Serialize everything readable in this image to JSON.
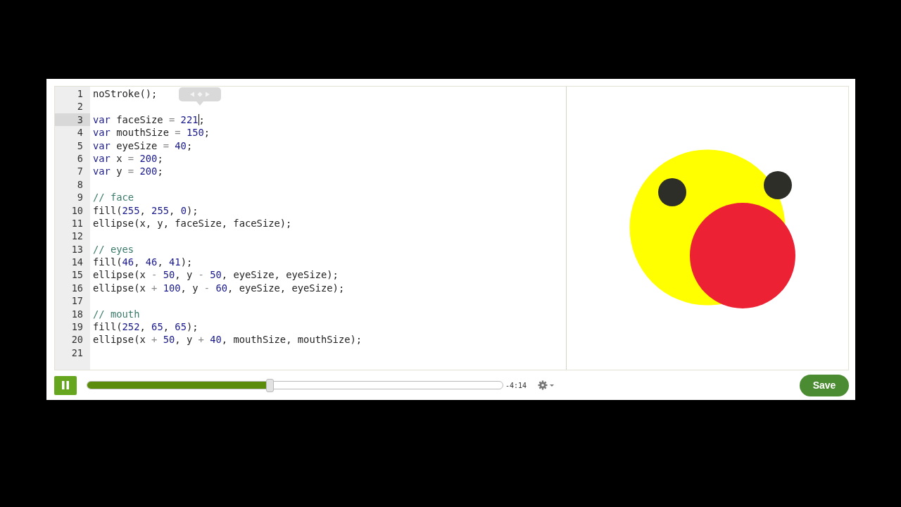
{
  "editor": {
    "lines": [
      {
        "number": "1",
        "active": false,
        "tokens": [
          {
            "kind": "text",
            "text": "noStroke();"
          }
        ]
      },
      {
        "number": "2",
        "active": false
      },
      {
        "number": "3",
        "active": true,
        "tokens": [
          {
            "kind": "keyword",
            "text": "var"
          },
          {
            "kind": "text",
            "text": " faceSize"
          },
          {
            "kind": "op",
            "text": " = "
          },
          {
            "kind": "number",
            "text": "221"
          },
          {
            "kind": "cursor"
          },
          {
            "kind": "text",
            "text": ";"
          }
        ]
      },
      {
        "number": "4",
        "active": false,
        "tokens": [
          {
            "kind": "keyword",
            "text": "var"
          },
          {
            "kind": "text",
            "text": " mouthSize"
          },
          {
            "kind": "op",
            "text": " = "
          },
          {
            "kind": "number",
            "text": "150"
          },
          {
            "kind": "text",
            "text": ";"
          }
        ]
      },
      {
        "number": "5",
        "active": false,
        "tokens": [
          {
            "kind": "keyword",
            "text": "var"
          },
          {
            "kind": "text",
            "text": " eyeSize"
          },
          {
            "kind": "op",
            "text": " = "
          },
          {
            "kind": "number",
            "text": "40"
          },
          {
            "kind": "text",
            "text": ";"
          }
        ]
      },
      {
        "number": "6",
        "active": false,
        "tokens": [
          {
            "kind": "keyword",
            "text": "var"
          },
          {
            "kind": "text",
            "text": " x"
          },
          {
            "kind": "op",
            "text": " = "
          },
          {
            "kind": "number",
            "text": "200"
          },
          {
            "kind": "text",
            "text": ";"
          }
        ]
      },
      {
        "number": "7",
        "active": false,
        "tokens": [
          {
            "kind": "keyword",
            "text": "var"
          },
          {
            "kind": "text",
            "text": " y"
          },
          {
            "kind": "op",
            "text": " = "
          },
          {
            "kind": "number",
            "text": "200"
          },
          {
            "kind": "text",
            "text": ";"
          }
        ]
      },
      {
        "number": "8",
        "active": false
      },
      {
        "number": "9",
        "active": false,
        "tokens": [
          {
            "kind": "comment",
            "text": "// face"
          }
        ]
      },
      {
        "number": "10",
        "active": false,
        "tokens": [
          {
            "kind": "text",
            "text": "fill("
          },
          {
            "kind": "number",
            "text": "255"
          },
          {
            "kind": "text",
            "text": ", "
          },
          {
            "kind": "number",
            "text": "255"
          },
          {
            "kind": "text",
            "text": ", "
          },
          {
            "kind": "number",
            "text": "0"
          },
          {
            "kind": "text",
            "text": ");"
          }
        ]
      },
      {
        "number": "11",
        "active": false,
        "tokens": [
          {
            "kind": "text",
            "text": "ellipse(x, y, faceSize, faceSize);"
          }
        ]
      },
      {
        "number": "12",
        "active": false
      },
      {
        "number": "13",
        "active": false,
        "tokens": [
          {
            "kind": "comment",
            "text": "// eyes"
          }
        ]
      },
      {
        "number": "14",
        "active": false,
        "tokens": [
          {
            "kind": "text",
            "text": "fill("
          },
          {
            "kind": "number",
            "text": "46"
          },
          {
            "kind": "text",
            "text": ", "
          },
          {
            "kind": "number",
            "text": "46"
          },
          {
            "kind": "text",
            "text": ", "
          },
          {
            "kind": "number",
            "text": "41"
          },
          {
            "kind": "text",
            "text": ");"
          }
        ]
      },
      {
        "number": "15",
        "active": false,
        "tokens": [
          {
            "kind": "text",
            "text": "ellipse(x"
          },
          {
            "kind": "op",
            "text": " - "
          },
          {
            "kind": "number",
            "text": "50"
          },
          {
            "kind": "text",
            "text": ", y"
          },
          {
            "kind": "op",
            "text": " - "
          },
          {
            "kind": "number",
            "text": "50"
          },
          {
            "kind": "text",
            "text": ", eyeSize, eyeSize);"
          }
        ]
      },
      {
        "number": "16",
        "active": false,
        "tokens": [
          {
            "kind": "text",
            "text": "ellipse(x"
          },
          {
            "kind": "op",
            "text": " + "
          },
          {
            "kind": "number",
            "text": "100"
          },
          {
            "kind": "text",
            "text": ", y"
          },
          {
            "kind": "op",
            "text": " - "
          },
          {
            "kind": "number",
            "text": "60"
          },
          {
            "kind": "text",
            "text": ", eyeSize, eyeSize);"
          }
        ]
      },
      {
        "number": "17",
        "active": false
      },
      {
        "number": "18",
        "active": false,
        "tokens": [
          {
            "kind": "comment",
            "text": "// mouth"
          }
        ]
      },
      {
        "number": "19",
        "active": false,
        "tokens": [
          {
            "kind": "text",
            "text": "fill("
          },
          {
            "kind": "number",
            "text": "252"
          },
          {
            "kind": "text",
            "text": ", "
          },
          {
            "kind": "number",
            "text": "65"
          },
          {
            "kind": "text",
            "text": ", "
          },
          {
            "kind": "number",
            "text": "65"
          },
          {
            "kind": "text",
            "text": ");"
          }
        ]
      },
      {
        "number": "20",
        "active": false,
        "tokens": [
          {
            "kind": "text",
            "text": "ellipse(x"
          },
          {
            "kind": "op",
            "text": " + "
          },
          {
            "kind": "number",
            "text": "50"
          },
          {
            "kind": "text",
            "text": ", y"
          },
          {
            "kind": "op",
            "text": " + "
          },
          {
            "kind": "number",
            "text": "40"
          },
          {
            "kind": "text",
            "text": ", mouthSize, mouthSize);"
          }
        ]
      },
      {
        "number": "21",
        "active": false
      }
    ]
  },
  "player": {
    "playing": true,
    "progress": {
      "level": 0.437
    },
    "time_remaining": "-4:14"
  },
  "save_button": "Save"
}
